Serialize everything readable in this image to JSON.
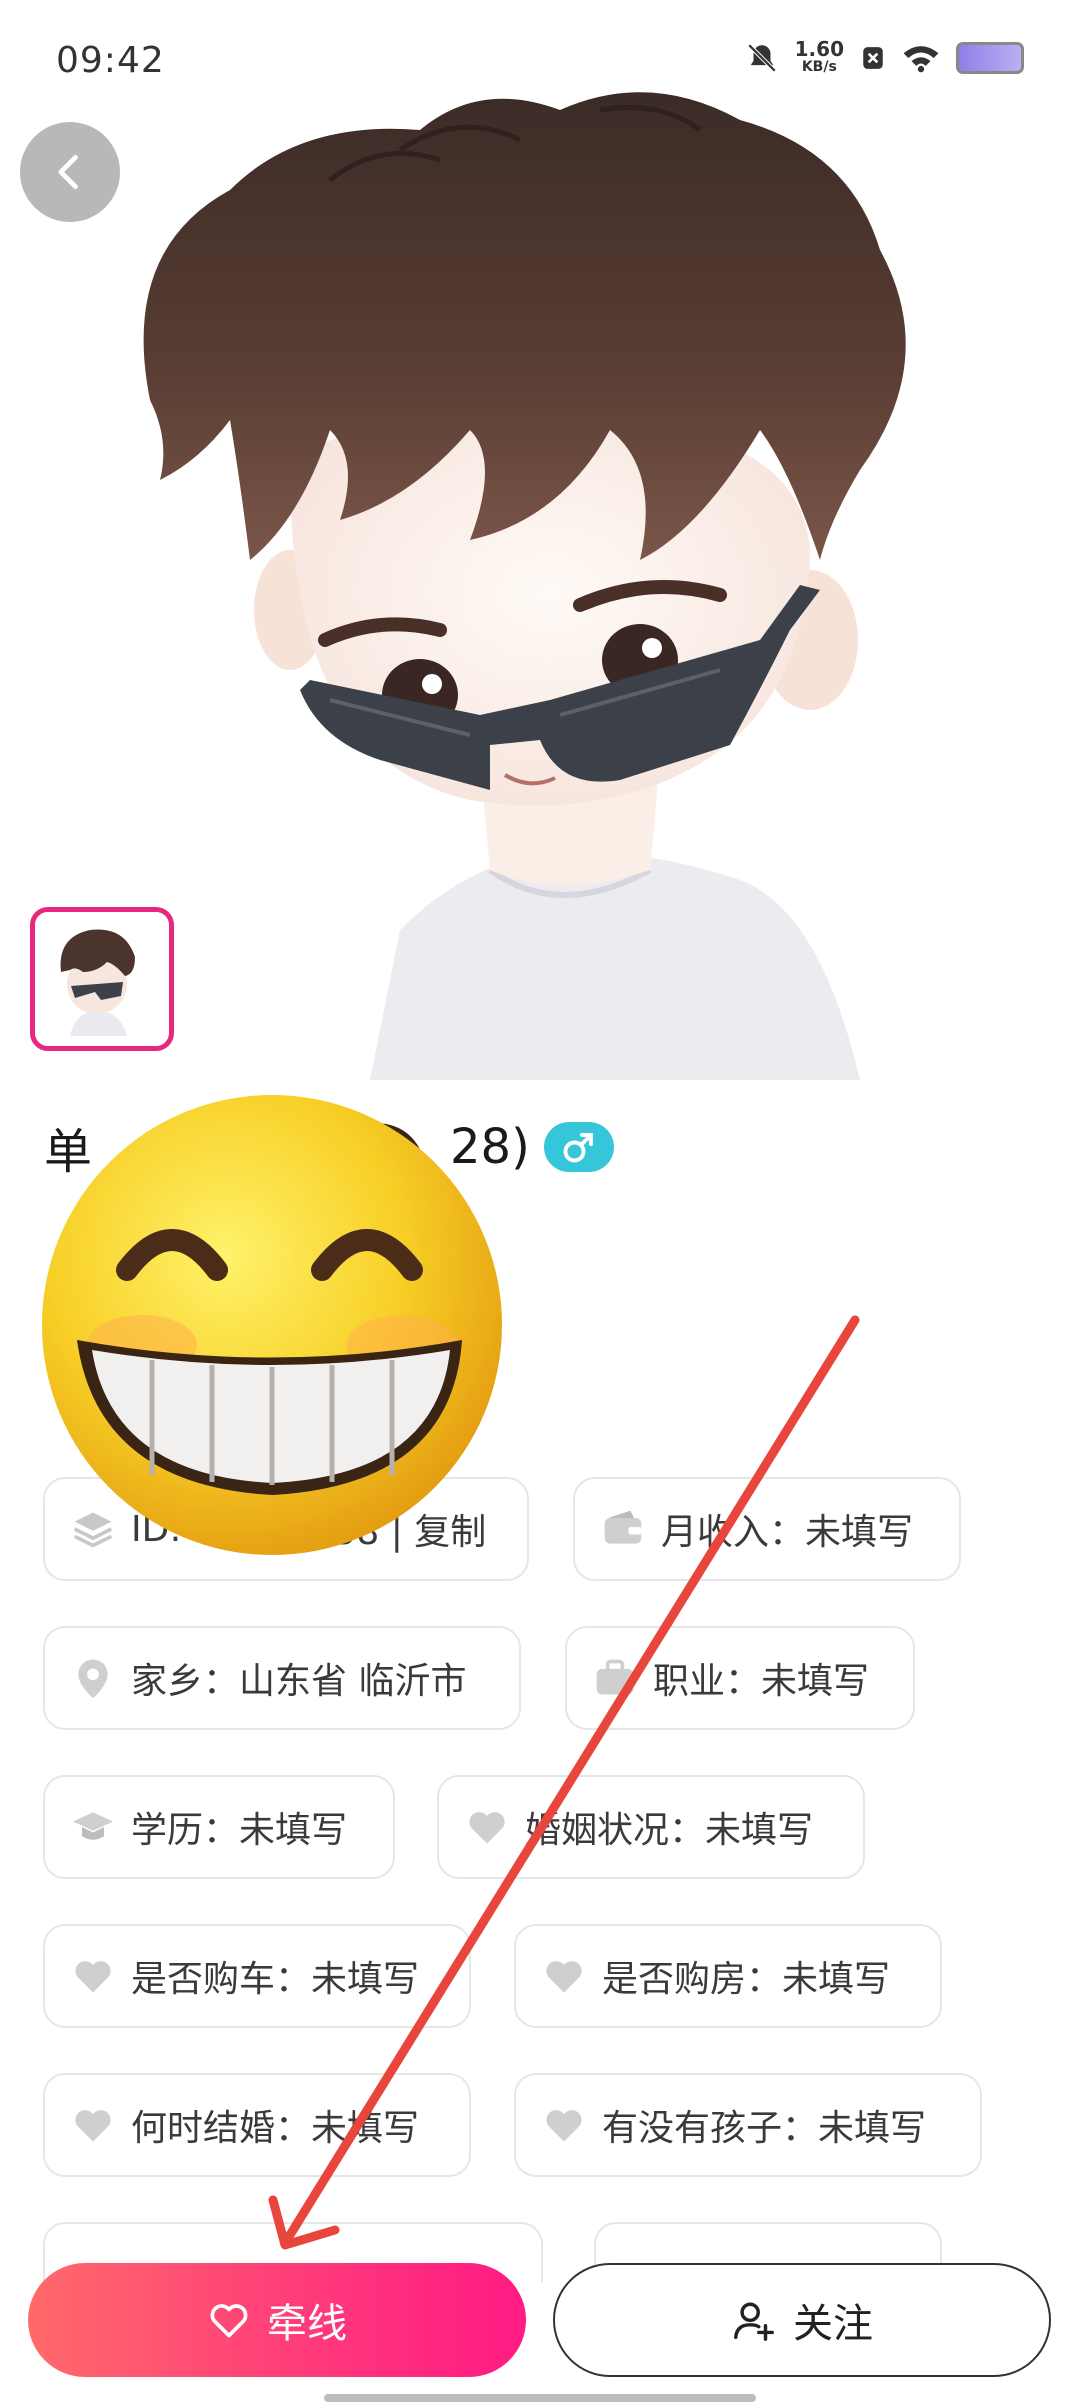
{
  "status_bar": {
    "time": "09:42",
    "net_speed": "1.60",
    "net_unit": "KB/s"
  },
  "profile": {
    "name_visible_start": "单",
    "name_visible_end": "28)"
  },
  "chips": {
    "id": "ID:",
    "id_tail": "58 | 复制",
    "income": "月收入：未填写",
    "hometown": "家乡：山东省 临沂市",
    "job": "职业：未填写",
    "education": "学历：未填写",
    "marital": "婚姻状况：未填写",
    "car": "是否购车：未填写",
    "house": "是否购房：未填写",
    "wedding": "何时结婚：未填写",
    "children": "有没有孩子：未填写"
  },
  "actions": {
    "qianxian": "牵线",
    "follow": "关注"
  },
  "colors": {
    "accent_pink": "#ff2f7e",
    "thumb_border": "#e8287f",
    "gender_badge": "#35c7d9",
    "annotation_arrow": "#e8453c"
  }
}
